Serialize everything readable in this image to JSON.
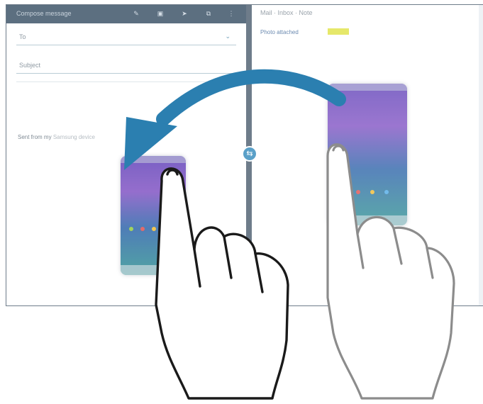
{
  "left_pane": {
    "title": "Compose message",
    "to_label": "To",
    "subject_label": "Subject",
    "signature_label": "Sent from my",
    "signature_device": "Samsung device"
  },
  "right_pane": {
    "title": "Mail · Inbox · Note",
    "subtitle": "Photo attached"
  },
  "icons": [
    "attach-icon",
    "send-icon",
    "save-icon",
    "more-icon",
    "chevron-down-icon",
    "window-swap-icon"
  ],
  "colors": {
    "arrow": "#2b7fb0",
    "screen_frame": "#6e7c8a",
    "toolbar": "#5c6f80",
    "handle": "#5aa0c8"
  }
}
